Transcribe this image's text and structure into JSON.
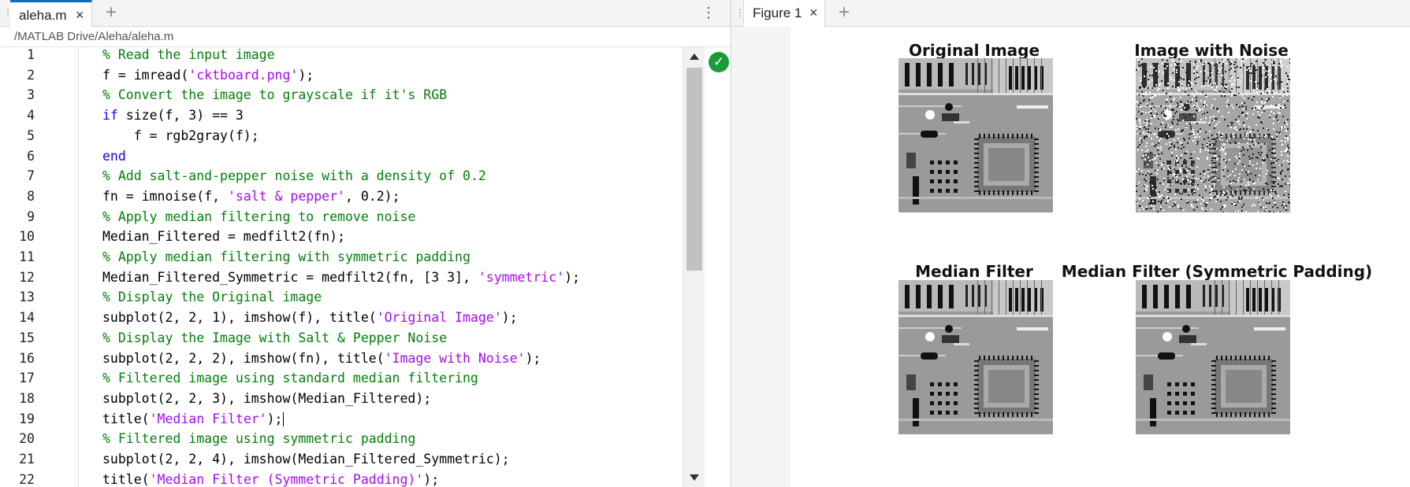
{
  "editor": {
    "tab_label": "aleha.m",
    "path": "/MATLAB Drive/Aleha/aleha.m",
    "lines": [
      {
        "n": "1",
        "segs": [
          {
            "t": "% Read the input image",
            "c": "comment"
          }
        ]
      },
      {
        "n": "2",
        "segs": [
          {
            "t": "f = imread(",
            "c": ""
          },
          {
            "t": "'cktboard.png'",
            "c": "str"
          },
          {
            "t": ");",
            "c": ""
          }
        ]
      },
      {
        "n": "3",
        "segs": [
          {
            "t": "% Convert the image to grayscale if it's RGB",
            "c": "comment"
          }
        ]
      },
      {
        "n": "4",
        "segs": [
          {
            "t": "if",
            "c": "kw"
          },
          {
            "t": " size(f, 3) == 3",
            "c": ""
          }
        ]
      },
      {
        "n": "5",
        "segs": [
          {
            "t": "    f = rgb2gray(f);",
            "c": ""
          }
        ]
      },
      {
        "n": "6",
        "segs": [
          {
            "t": "end",
            "c": "kw"
          }
        ]
      },
      {
        "n": "7",
        "segs": [
          {
            "t": "% Add salt-and-pepper noise with a density of 0.2",
            "c": "comment"
          }
        ]
      },
      {
        "n": "8",
        "segs": [
          {
            "t": "fn = imnoise(f, ",
            "c": ""
          },
          {
            "t": "'salt & pepper'",
            "c": "str"
          },
          {
            "t": ", 0.2);",
            "c": ""
          }
        ]
      },
      {
        "n": "9",
        "segs": [
          {
            "t": "% Apply median filtering to remove noise",
            "c": "comment"
          }
        ]
      },
      {
        "n": "10",
        "segs": [
          {
            "t": "Median_Filtered = medfilt2(fn);",
            "c": ""
          }
        ]
      },
      {
        "n": "11",
        "segs": [
          {
            "t": "% Apply median filtering with symmetric padding",
            "c": "comment"
          }
        ]
      },
      {
        "n": "12",
        "segs": [
          {
            "t": "Median_Filtered_Symmetric = medfilt2(fn, [3 3], ",
            "c": ""
          },
          {
            "t": "'symmetric'",
            "c": "str"
          },
          {
            "t": ");",
            "c": ""
          }
        ]
      },
      {
        "n": "13",
        "segs": [
          {
            "t": "% Display the Original image",
            "c": "comment"
          }
        ]
      },
      {
        "n": "14",
        "segs": [
          {
            "t": "subplot(2, 2, 1), imshow(f), title(",
            "c": ""
          },
          {
            "t": "'Original Image'",
            "c": "str"
          },
          {
            "t": ");",
            "c": ""
          }
        ]
      },
      {
        "n": "15",
        "segs": [
          {
            "t": "% Display the Image with Salt & Pepper Noise",
            "c": "comment"
          }
        ]
      },
      {
        "n": "16",
        "segs": [
          {
            "t": "subplot(2, 2, 2), imshow(fn), title(",
            "c": ""
          },
          {
            "t": "'Image with Noise'",
            "c": "str"
          },
          {
            "t": ");",
            "c": ""
          }
        ]
      },
      {
        "n": "17",
        "segs": [
          {
            "t": "% Filtered image using standard median filtering",
            "c": "comment"
          }
        ]
      },
      {
        "n": "18",
        "segs": [
          {
            "t": "subplot(2, 2, 3), imshow(Median_Filtered);",
            "c": ""
          }
        ]
      },
      {
        "n": "19",
        "segs": [
          {
            "t": "title(",
            "c": ""
          },
          {
            "t": "'Median Filter'",
            "c": "str"
          },
          {
            "t": ");",
            "c": ""
          }
        ],
        "cursor": true
      },
      {
        "n": "20",
        "segs": [
          {
            "t": "% Filtered image using symmetric padding",
            "c": "comment"
          }
        ]
      },
      {
        "n": "21",
        "segs": [
          {
            "t": "subplot(2, 2, 4), imshow(Median_Filtered_Symmetric);",
            "c": ""
          }
        ]
      },
      {
        "n": "22",
        "segs": [
          {
            "t": "title(",
            "c": ""
          },
          {
            "t": "'Median Filter (Symmetric Padding)'",
            "c": "str"
          },
          {
            "t": ");",
            "c": ""
          }
        ]
      }
    ]
  },
  "figure": {
    "tab_label": "Figure 1",
    "subplots": [
      {
        "title": "Original Image",
        "kind": "original"
      },
      {
        "title": "Image with Noise",
        "kind": "noise"
      },
      {
        "title": "Median Filter",
        "kind": "filtered"
      },
      {
        "title": "Median Filter (Symmetric Padding)",
        "kind": "filtered"
      }
    ]
  },
  "icons": {
    "tab_close": "×",
    "tab_add": "+",
    "kebab": "⋮",
    "grip": "⋮",
    "status_check": "✓"
  },
  "colors": {
    "comment": "#028009",
    "keyword": "#0e00ff",
    "string": "#a709f5",
    "accent": "#0b6ebd",
    "status_ok": "#1a9b3a"
  }
}
